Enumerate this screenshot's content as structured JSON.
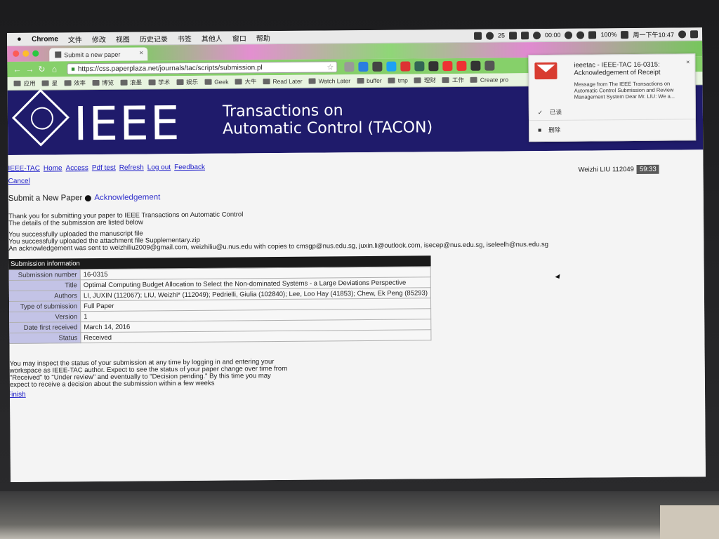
{
  "menubar": {
    "app": "Chrome",
    "menus": [
      "文件",
      "修改",
      "视图",
      "历史记录",
      "书签",
      "其他人",
      "窗口",
      "帮助"
    ],
    "badge": "25",
    "timer": "00:00",
    "battery": "100%",
    "clock": "周一下午10:47"
  },
  "tab": {
    "title": "Submit a new paper",
    "close": "×"
  },
  "address": {
    "url": "https://css.paperplaza.net/journals/tac/scripts/submission.pl"
  },
  "bookmarks": [
    "应用",
    "星",
    "效率",
    "博览",
    "浪墨",
    "学术",
    "娱乐",
    "Geek",
    "大牛",
    "Read Later",
    "Watch Later",
    "buffer",
    "tmp",
    "理财",
    "工作",
    "Create pro"
  ],
  "header": {
    "logo_text": "IEEE",
    "title_line1": "Transactions on",
    "title_line2": "Automatic Control (TACON)"
  },
  "nav": {
    "links": [
      "IEEE-TAC",
      "Home",
      "Access",
      "Pdf test",
      "Refresh",
      "Log out",
      "Feedback"
    ],
    "cancel": "Cancel"
  },
  "user": {
    "name": "Weizhi LIU 112049",
    "timer": "59:33"
  },
  "breadcrumb": {
    "step1": "Submit a New Paper",
    "step2": "Acknowledgement"
  },
  "messages": {
    "line1": "Thank you for submitting your paper to IEEE Transactions on Automatic Control",
    "line2": "The details of the submission are listed below",
    "line3": "You successfully uploaded the manuscript file",
    "line4": "You successfully uploaded the attachment file Supplementary.zip",
    "line5": "An acknowledgement was sent to weizhiliu2009@gmail.com, weizhiliu@u.nus.edu with copies to cmsgp@nus.edu.sg, juxin.li@outlook.com, isecep@nus.edu.sg, iseleelh@nus.edu.sg"
  },
  "table": {
    "heading": "Submission information",
    "rows": [
      {
        "label": "Submission number",
        "value": "16-0315"
      },
      {
        "label": "Title",
        "value": "Optimal Computing Budget Allocation to Select the Non-dominated Systems - a Large Deviations Perspective"
      },
      {
        "label": "Authors",
        "value": "LI, JUXIN (112067); LIU, Weizhi* (112049); Pedrielli, Giulia (102840); Lee, Loo Hay (41853); Chew, Ek Peng (85293)"
      },
      {
        "label": "Type of submission",
        "value": "Full Paper"
      },
      {
        "label": "Version",
        "value": "1"
      },
      {
        "label": "Date first received",
        "value": "March 14, 2016"
      },
      {
        "label": "Status",
        "value": "Received"
      }
    ]
  },
  "footer_text": {
    "line1": "You may inspect the status of your submission at any time by logging in and entering your",
    "line2": "workspace as IEEE-TAC author. Expect to see the status of your paper change over time from",
    "line3": "\"Received\" to \"Under review\" and eventually to \"Decision pending.\" By this time you may",
    "line4": "expect to receive a decision about the submission within a few weeks"
  },
  "finish": "Finish",
  "notification": {
    "title": "ieeetac - IEEE-TAC 16-0315: Acknowledgement of Receipt",
    "body": "Message from The IEEE Transactions on Automatic Control Submission and Review Management System Dear Mr. LIU: We a...",
    "action_read": "已读",
    "action_delete": "删除",
    "close": "×"
  }
}
